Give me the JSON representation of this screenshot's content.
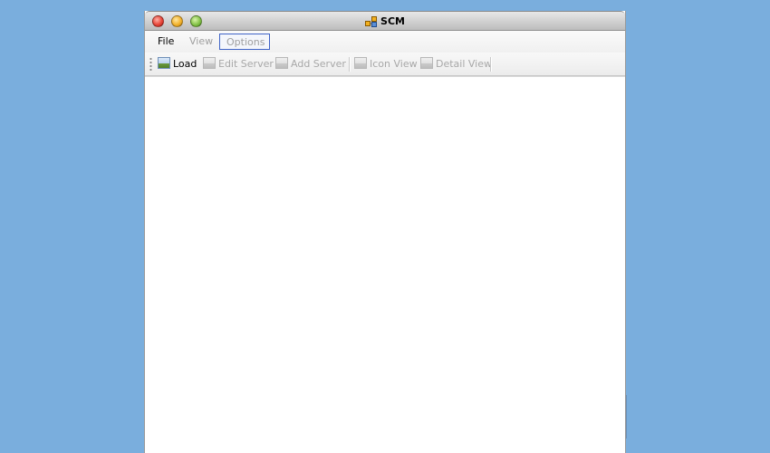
{
  "window": {
    "title": "SCM",
    "buttons": {
      "close": "close",
      "minimize": "minimize",
      "maximize": "maximize"
    }
  },
  "menubar": {
    "items": [
      {
        "label": "File",
        "enabled": true
      },
      {
        "label": "View",
        "enabled": false
      },
      {
        "label": "Options",
        "enabled": false,
        "focused": true
      }
    ]
  },
  "toolbar": {
    "load": {
      "label": "Load",
      "icon": "image-icon",
      "enabled": true
    },
    "edit_server": {
      "label": "Edit Server",
      "icon": "image-icon",
      "enabled": false
    },
    "add_server": {
      "label": "Add Server",
      "icon": "image-icon",
      "enabled": false
    },
    "icon_view": {
      "label": "Icon View",
      "icon": "image-icon",
      "enabled": false
    },
    "detail_view": {
      "label": "Detail View",
      "icon": "image-icon",
      "enabled": false
    }
  },
  "colors": {
    "desktop": "#7aaedd",
    "focus_border": "#3f63c7",
    "disabled_text": "#a8a8a8"
  }
}
